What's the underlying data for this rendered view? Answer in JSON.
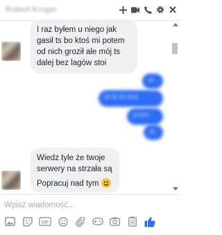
{
  "header": {
    "contact_name": "Robert Kruger",
    "icons": [
      "plus-icon",
      "video-call-icon",
      "phone-icon",
      "gear-icon",
      "close-icon"
    ]
  },
  "messages": {
    "incoming_1": {
      "lines": [
        "I raz byłem u niego jak",
        "gasił ts bo ktoś mi potem",
        "od nich groził ale mój ts",
        "dalej bez lagów stoi"
      ]
    },
    "outgoing_blurred": [
      "ok",
      "ok ok ok okay",
      "pozdro",
      "ok"
    ],
    "incoming_2": {
      "lines": [
        "Wiedz tyle że twoje",
        "serwery na strzała są ;D"
      ]
    },
    "incoming_3": {
      "text": "Popracuj nad tym"
    }
  },
  "composer": {
    "placeholder": "Wpisz wiadomość...",
    "tools": [
      "photo-icon",
      "sticker-icon",
      "gif-icon",
      "emoji-icon",
      "attachment-icon",
      "game-icon",
      "camera-icon",
      "clipboard-icon",
      "like-icon"
    ],
    "gif_label": "GIF"
  },
  "colors": {
    "accent": "#2f6df1",
    "incoming_bubble": "#f1f0f0",
    "icon_gray": "#4b4f56"
  }
}
